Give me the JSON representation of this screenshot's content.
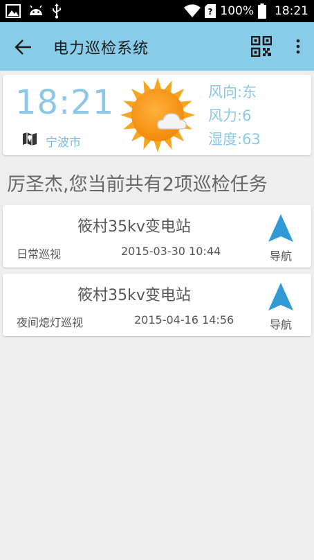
{
  "status_bar": {
    "battery": "100%",
    "time": "18:21",
    "icons": [
      "image-icon",
      "android-icon",
      "usb-icon",
      "wifi-icon",
      "sim-icon",
      "battery-icon"
    ]
  },
  "app_bar": {
    "title": "电力巡检系统",
    "icons": [
      "back-arrow-icon",
      "qr-code-icon",
      "more-vert-icon"
    ],
    "color": "#87cdea"
  },
  "weather": {
    "time": "18:21",
    "city": "宁波市",
    "wind_direction": "风向:东",
    "wind_force": "风力:6",
    "humidity": "湿度:63",
    "icon": "partly-sunny-icon",
    "accent_color": "#8cc7e6"
  },
  "summary": "厉圣杰,您当前共有2项巡检任务",
  "tasks": [
    {
      "station": "筱村35kv变电站",
      "type": "日常巡视",
      "datetime": "2015-03-30 10:44",
      "nav_label": "导航"
    },
    {
      "station": "筱村35kv变电站",
      "type": "夜间熄灯巡视",
      "datetime": "2015-04-16 14:56",
      "nav_label": "导航"
    }
  ],
  "nav_icon_color": "#2f9ad6"
}
